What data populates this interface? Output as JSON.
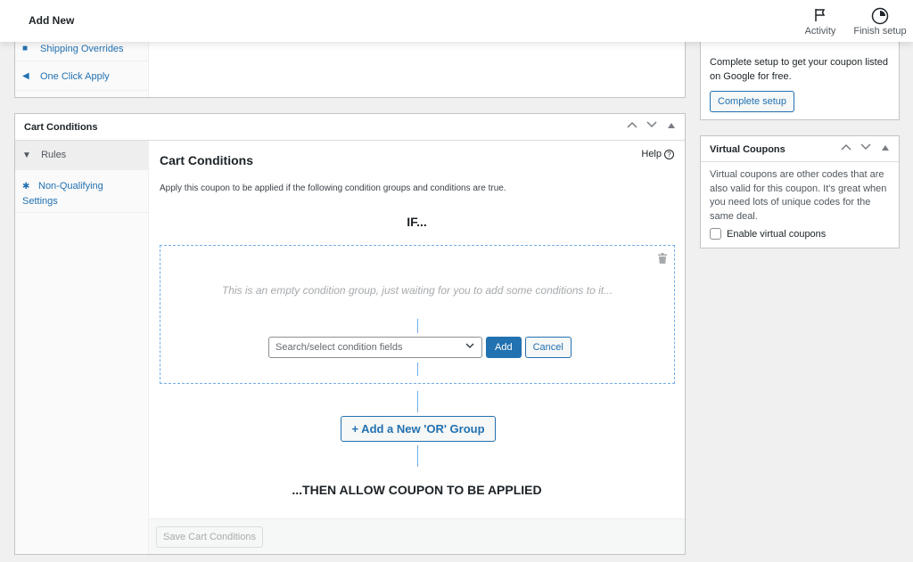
{
  "header": {
    "title": "Add New",
    "actions": [
      {
        "label": "Activity",
        "icon": "flag-icon"
      },
      {
        "label": "Finish setup",
        "icon": "progress-circle-icon"
      }
    ]
  },
  "top_panel": {
    "nav_items": [
      {
        "label": "Shipping Overrides",
        "icon": "truck-icon"
      },
      {
        "label": "One Click Apply",
        "icon": "megaphone-icon"
      }
    ]
  },
  "cart_conditions": {
    "panel_title": "Cart Conditions",
    "controls": {
      "up": "^",
      "down": "v",
      "toggle": "▲"
    },
    "tabs": [
      {
        "label": "Rules",
        "icon": "filter-icon",
        "active": true
      },
      {
        "label": "Non-Qualifying Settings",
        "icon": "gear-icon",
        "active": false
      }
    ],
    "title": "Cart Conditions",
    "help_label": "Help",
    "description": "Apply this coupon to be applied if the following condition groups and conditions are true.",
    "if_label": "IF...",
    "empty_group_message": "This is an empty condition group, just waiting for you to add some conditions to it...",
    "select_placeholder": "Search/select condition fields",
    "add_label": "Add",
    "cancel_label": "Cancel",
    "add_or_group_label": "+ Add a New 'OR' Group",
    "then_label": "...THEN ALLOW COUPON TO BE APPLIED",
    "save_label": "Save Cart Conditions"
  },
  "google_panel": {
    "text": "Complete setup to get your coupon listed on Google for free.",
    "button_label": "Complete setup"
  },
  "virtual_coupons": {
    "title": "Virtual Coupons",
    "description": "Virtual coupons are other codes that are also valid for this coupon. It's great when you need lots of unique codes for the same deal.",
    "checkbox_label": "Enable virtual coupons",
    "checkbox_checked": false
  },
  "colors": {
    "accent": "#2271b1",
    "dashed_border": "#72aee6",
    "background": "#f0f0f1"
  }
}
